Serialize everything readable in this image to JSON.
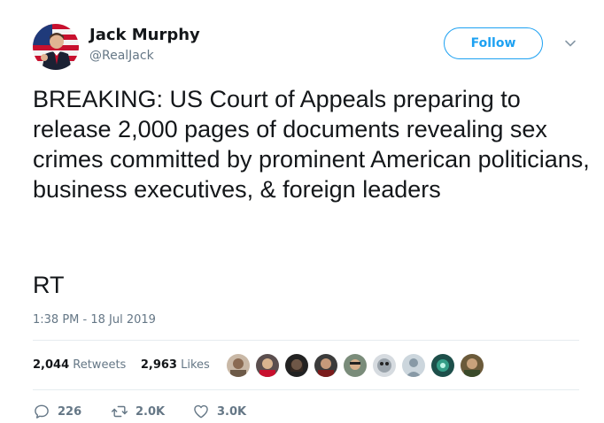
{
  "user": {
    "name": "Jack Murphy",
    "handle": "@RealJack"
  },
  "follow_label": "Follow",
  "tweet": {
    "text": "BREAKING: US Court of Appeals preparing to release 2,000 pages of documents revealing sex crimes committed by prominent American politicians, business executives, & foreign leaders",
    "text2": "RT",
    "timestamp": "1:38 PM - 18 Jul 2019"
  },
  "stats": {
    "retweets_count": "2,044",
    "retweets_label": "Retweets",
    "likes_count": "2,963",
    "likes_label": "Likes"
  },
  "actions": {
    "replies": "226",
    "retweets": "2.0K",
    "likes": "3.0K"
  },
  "colors": {
    "accent": "#1da1f2",
    "muted": "#657786",
    "text": "#14171a"
  }
}
